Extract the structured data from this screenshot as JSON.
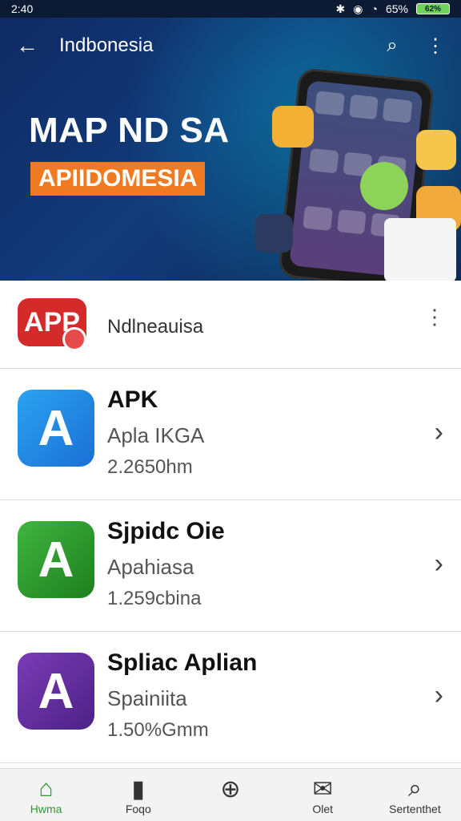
{
  "status_bar": {
    "time": "2:40",
    "battery": "62%",
    "signal_text": "65%"
  },
  "hero": {
    "title": "Indbonesia",
    "headline": "MAP ND SA",
    "subheadline": "APIIDOMESIA",
    "back_icon": "arrow-left-icon",
    "search_icon": "search-icon",
    "more_icon": "more-vertical-icon"
  },
  "list": {
    "header": {
      "icon_text": "APP",
      "label": "Ndlneauisa"
    },
    "apps": [
      {
        "icon": "a-icon",
        "name": "APK",
        "sub": "Apla IKGA",
        "meta": "2.2650hm",
        "color": "#1f8ae3"
      },
      {
        "icon": "a-plus-icon",
        "name": "Sjpidc Oie",
        "sub": "Apahiasa",
        "meta": "1.259cbina",
        "color": "#2c9a2c"
      },
      {
        "icon": "a-circle-icon",
        "name": "Spliac Aplian",
        "sub": "Spainiita",
        "meta": "1.50%Gmm",
        "color": "#5b2c91"
      }
    ]
  },
  "bottom_nav": {
    "items": [
      {
        "icon": "home-icon",
        "label": "Hwma",
        "active": true
      },
      {
        "icon": "book-icon",
        "label": "Foqo",
        "active": false
      },
      {
        "icon": "plus-circle-icon",
        "label": "",
        "active": false
      },
      {
        "icon": "mail-icon",
        "label": "Olet",
        "active": false
      },
      {
        "icon": "search-icon",
        "label": "Sertenthet",
        "active": false
      }
    ]
  }
}
